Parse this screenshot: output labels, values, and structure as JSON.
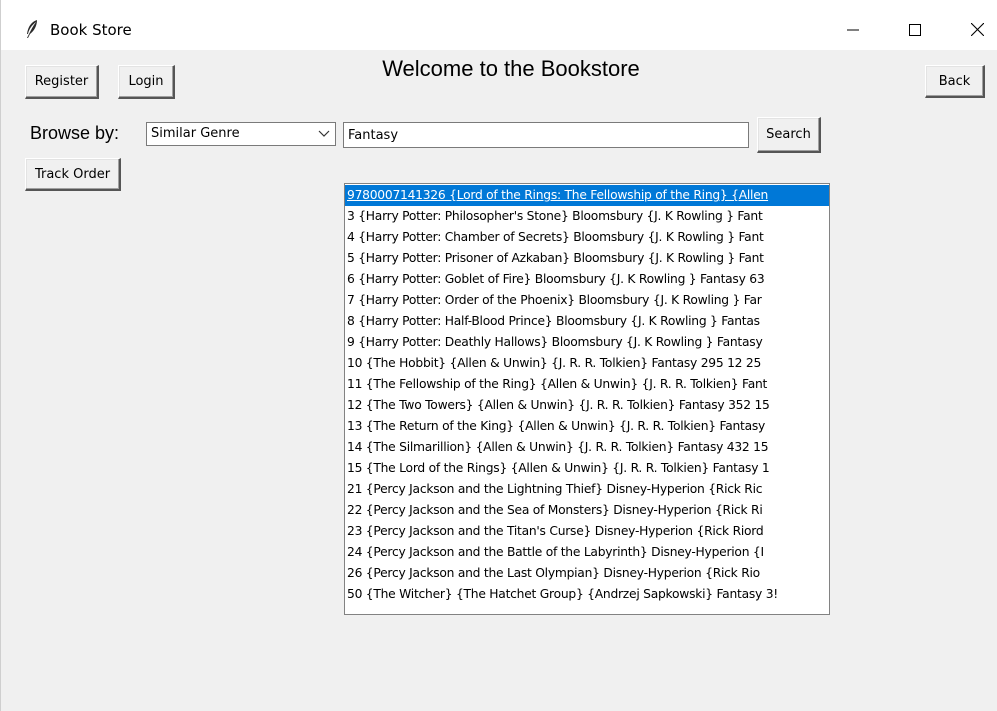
{
  "window": {
    "title": "Book Store"
  },
  "header": {
    "register_label": "Register",
    "login_label": "Login",
    "heading": "Welcome to the Bookstore",
    "back_label": "Back"
  },
  "browse": {
    "label": "Browse by:",
    "selected_option": "Similar Genre",
    "search_value": "Fantasy",
    "search_button_label": "Search"
  },
  "track_order_label": "Track Order",
  "results": {
    "selected_index": 0,
    "items": [
      "9780007141326 {Lord of the Rings: The Fellowship of the Ring} {Allen",
      "3 {Harry Potter: Philosopher's Stone} Bloomsbury {J. K Rowling } Fant",
      "4 {Harry Potter: Chamber of Secrets} Bloomsbury {J. K Rowling } Fant",
      "5 {Harry Potter: Prisoner of Azkaban} Bloomsbury {J. K Rowling } Fant",
      "6 {Harry Potter: Goblet of Fire} Bloomsbury {J. K Rowling } Fantasy 63",
      "7 {Harry Potter: Order of the Phoenix} Bloomsbury {J. K Rowling } Far",
      "8 {Harry Potter: Half-Blood Prince} Bloomsbury {J. K Rowling } Fantas",
      "9 {Harry Potter: Deathly Hallows} Bloomsbury {J. K Rowling } Fantasy",
      "10 {The Hobbit} {Allen & Unwin} {J. R. R. Tolkien} Fantasy 295 12 25",
      "11 {The Fellowship of the Ring} {Allen & Unwin} {J. R. R. Tolkien} Fant",
      "12 {The Two Towers} {Allen & Unwin} {J. R. R. Tolkien} Fantasy 352 15",
      "13 {The Return of the King} {Allen & Unwin} {J. R. R. Tolkien} Fantasy",
      "14 {The Silmarillion} {Allen & Unwin} {J. R. R. Tolkien} Fantasy 432 15",
      "15 {The Lord of the Rings} {Allen & Unwin} {J. R. R. Tolkien} Fantasy 1",
      "21 {Percy Jackson and the Lightning Thief} Disney-Hyperion {Rick Ric",
      "22 {Percy Jackson and the Sea of Monsters} Disney-Hyperion {Rick Ri",
      "23 {Percy Jackson and the Titan's Curse} Disney-Hyperion {Rick Riord",
      "24 {Percy Jackson and the Battle of the Labyrinth} Disney-Hyperion {I",
      "26 {Percy Jackson and the Last Olympian} Disney-Hyperion {Rick Rio",
      "50 {The Witcher} {The Hatchet Group} {Andrzej Sapkowski} Fantasy 3!"
    ]
  },
  "colors": {
    "selection": "#0078d7",
    "window_bg": "#f0f0f0"
  },
  "icons": {
    "app": "feather-icon",
    "minimize": "minimize-icon",
    "maximize": "maximize-icon",
    "close": "close-icon",
    "dropdown": "chevron-down-icon"
  }
}
